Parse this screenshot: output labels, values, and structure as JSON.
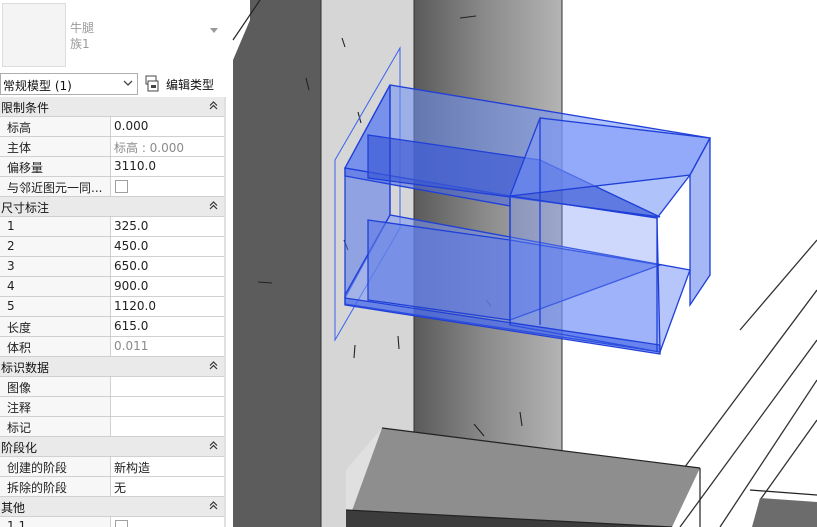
{
  "type_selector": {
    "family_line1": "牛腿",
    "family_line2": "族1"
  },
  "category_select": {
    "value": "常规模型 (1)"
  },
  "edit_type_button": {
    "label": "编辑类型"
  },
  "groups": {
    "constraints": {
      "title": "限制条件"
    },
    "dimensions": {
      "title": "尺寸标注"
    },
    "identity": {
      "title": "标识数据"
    },
    "phasing": {
      "title": "阶段化"
    },
    "other": {
      "title": "其他"
    }
  },
  "constraints": {
    "level": {
      "name": "标高",
      "value": "0.000"
    },
    "host": {
      "name": "主体",
      "value": "标高 : 0.000"
    },
    "offset": {
      "name": "偏移量",
      "value": "3110.0"
    },
    "move_with_nearby": {
      "name": "与邻近图元一同...",
      "checked": false
    }
  },
  "dimensions": {
    "d1": {
      "name": "1",
      "value": "325.0"
    },
    "d2": {
      "name": "2",
      "value": "450.0"
    },
    "d3": {
      "name": "3",
      "value": "650.0"
    },
    "d4": {
      "name": "4",
      "value": "900.0"
    },
    "d5": {
      "name": "5",
      "value": "1120.0"
    },
    "length": {
      "name": "长度",
      "value": "615.0"
    },
    "volume": {
      "name": "体积",
      "value": "0.011"
    }
  },
  "identity": {
    "image": {
      "name": "图像",
      "value": ""
    },
    "comments": {
      "name": "注释",
      "value": ""
    },
    "mark": {
      "name": "标记",
      "value": ""
    }
  },
  "phasing": {
    "created": {
      "name": "创建的阶段",
      "value": "新构造"
    },
    "demolished": {
      "name": "拆除的阶段",
      "value": "无"
    }
  },
  "other": {
    "row1": {
      "name": "1.1"
    }
  },
  "colors": {
    "selection_blue": "#3a62f0",
    "viewport_border": "#28d6e2",
    "wall_dark": "#5a5a5a",
    "wall_mid": "#9a9a9a"
  }
}
